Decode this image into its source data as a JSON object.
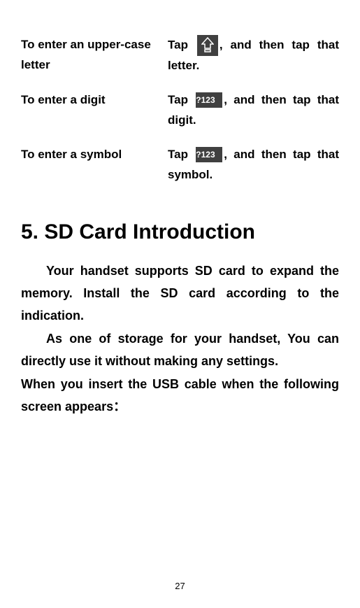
{
  "instructions": [
    {
      "label": "To enter an upper-case letter",
      "pre": "Tap ",
      "icon": "shift",
      "post": ", and then tap that letter."
    },
    {
      "label": "To enter a digit",
      "pre": "Tap ",
      "icon": "num",
      "icon_text": "?123",
      "post": ", and then tap that digit."
    },
    {
      "label": "To enter a symbol",
      "pre": "Tap ",
      "icon": "num",
      "icon_text": "?123",
      "post": ", and then tap that symbol."
    }
  ],
  "section": {
    "title": "5. SD Card Introduction",
    "p1": "Your handset supports SD card to expand the memory. Install the SD card according to the indication.",
    "p2": "As one of storage for your handset,  You can directly use it without making any settings.",
    "p3": "When you insert the USB cable when the following screen appears："
  },
  "page_number": "27"
}
